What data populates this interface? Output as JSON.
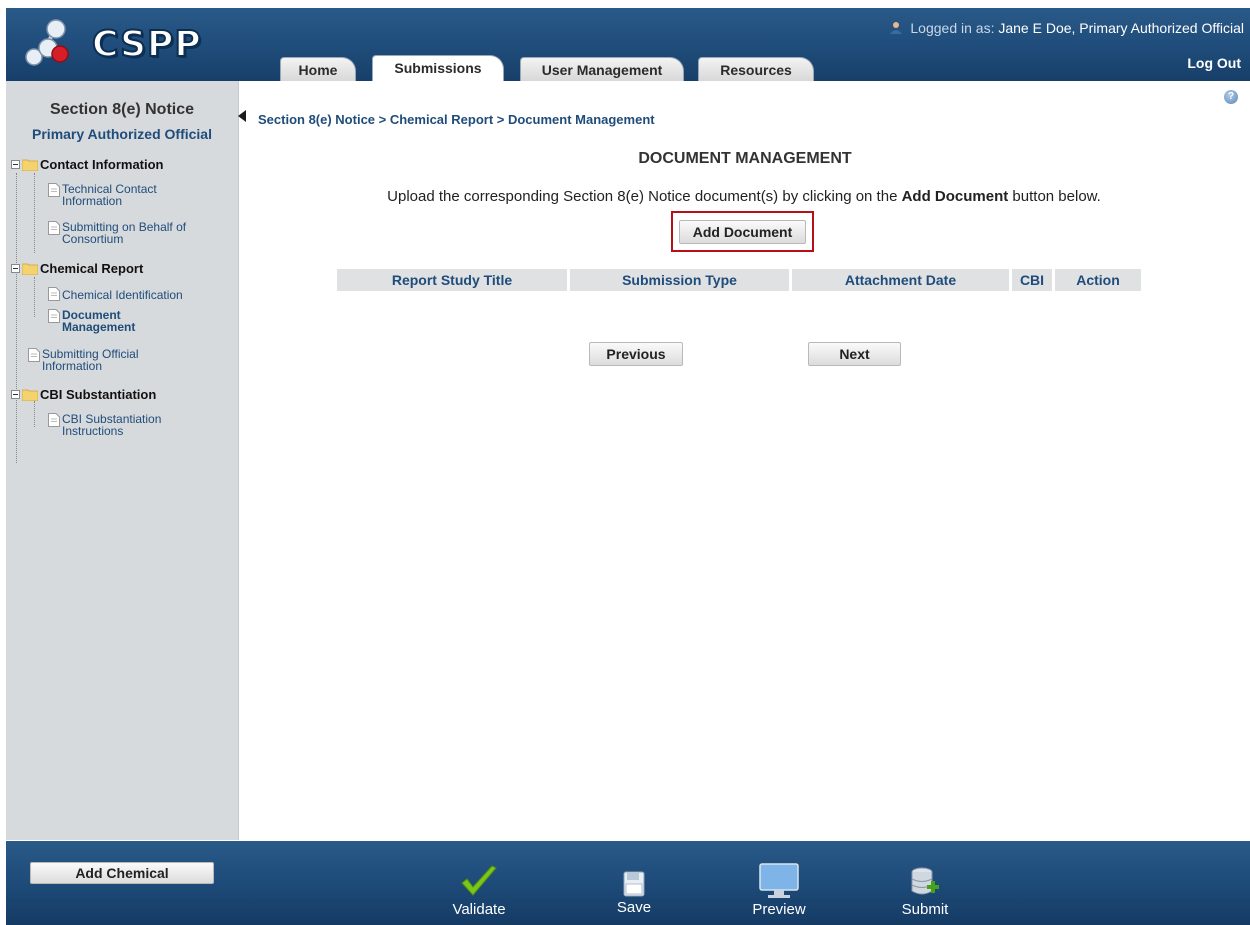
{
  "app": {
    "logo_text": "CSPP",
    "logged_in_label": "Logged in as:",
    "user_name": "Jane E Doe, Primary Authorized Official",
    "logout_label": "Log Out"
  },
  "tabs": [
    {
      "label": "Home",
      "active": false
    },
    {
      "label": "Submissions",
      "active": true
    },
    {
      "label": "User Management",
      "active": false
    },
    {
      "label": "Resources",
      "active": false
    }
  ],
  "sidebar": {
    "title": "Section 8(e) Notice",
    "subtitle": "Primary Authorized Official",
    "tree": [
      {
        "type": "folder",
        "label": "Contact Information"
      },
      {
        "type": "doc",
        "label_line1": "Technical Contact",
        "label_line2": "Information"
      },
      {
        "type": "doc",
        "label_line1": "Submitting on Behalf of",
        "label_line2": "Consortium"
      },
      {
        "type": "folder",
        "label": "Chemical Report"
      },
      {
        "type": "doc",
        "label": "Chemical Identification"
      },
      {
        "type": "doc",
        "label_line1": "Document",
        "label_line2": "Management",
        "current": true
      },
      {
        "type": "doc",
        "label_line1": "Submitting Official",
        "label_line2": "Information"
      },
      {
        "type": "folder",
        "label": "CBI Substantiation"
      },
      {
        "type": "doc",
        "label_line1": "CBI Substantiation",
        "label_line2": "Instructions"
      }
    ]
  },
  "main": {
    "breadcrumb": "Section 8(e) Notice > Chemical Report > Document Management",
    "title": "DOCUMENT MANAGEMENT",
    "instructions_pre": "Upload the corresponding Section 8(e) Notice document(s) by clicking on the ",
    "instructions_bold": "Add Document",
    "instructions_post": " button below.",
    "add_document_label": "Add Document",
    "table_headers": [
      "Report Study Title",
      "Submission Type",
      "Attachment Date",
      "CBI",
      "Action"
    ],
    "previous_label": "Previous",
    "next_label": "Next"
  },
  "footer": {
    "add_chemical_label": "Add Chemical",
    "validate_label": "Validate",
    "save_label": "Save",
    "preview_label": "Preview",
    "submit_label": "Submit"
  },
  "colors": {
    "header_blue": "#1f4c7a",
    "sidebar_gray": "#d7dadd",
    "highlight_red": "#b5101a",
    "validate_green": "#7cc519"
  }
}
